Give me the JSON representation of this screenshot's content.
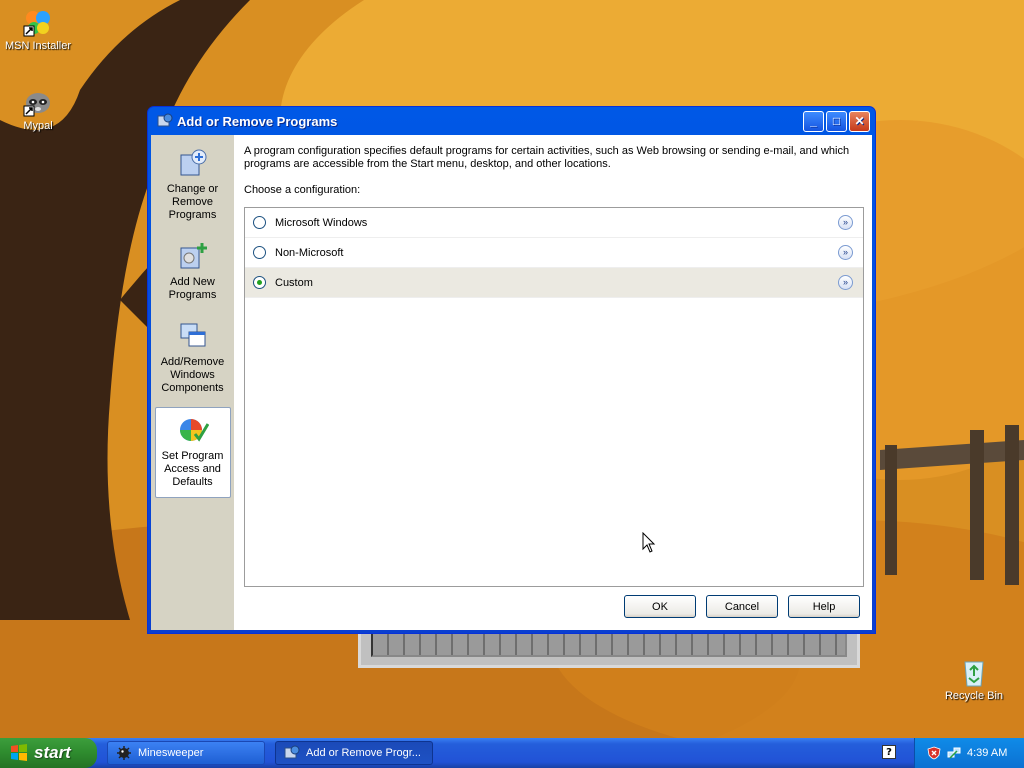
{
  "desktop": {
    "icons": [
      {
        "label": "MSN Installer",
        "icon": "msn-butterfly-icon"
      },
      {
        "label": "Mypal",
        "icon": "raccoon-icon"
      },
      {
        "label": "Recycle Bin",
        "icon": "recycle-bin-icon"
      }
    ]
  },
  "window": {
    "title": "Add or Remove Programs",
    "controls": {
      "minimize": "_",
      "maximize": "□",
      "close": "✕"
    }
  },
  "sidebar": {
    "items": [
      {
        "label": "Change or Remove Programs",
        "icon": "change-remove-programs-icon",
        "selected": false
      },
      {
        "label": "Add New Programs",
        "icon": "add-new-programs-icon",
        "selected": false
      },
      {
        "label": "Add/Remove Windows Components",
        "icon": "windows-components-icon",
        "selected": false
      },
      {
        "label": "Set Program Access and Defaults",
        "icon": "program-access-defaults-icon",
        "selected": true
      }
    ]
  },
  "main": {
    "intro": "A program configuration specifies default programs for certain activities, such as Web browsing or sending e-mail, and which programs are accessible from the Start menu, desktop, and other locations.",
    "choose_label": "Choose a configuration:",
    "configurations": [
      {
        "label": "Microsoft Windows",
        "selected": false
      },
      {
        "label": "Non-Microsoft",
        "selected": false
      },
      {
        "label": "Custom",
        "selected": true
      }
    ],
    "expand_glyph": "»"
  },
  "buttons": {
    "ok": "OK",
    "cancel": "Cancel",
    "help": "Help"
  },
  "taskbar": {
    "start_label": "start",
    "tasks": [
      {
        "label": "Minesweeper",
        "active": false
      },
      {
        "label": "Add or Remove Progr...",
        "active": true
      }
    ],
    "help_glyph": "?",
    "clock": "4:39 AM"
  },
  "colors": {
    "title_bar": "#0058e6",
    "taskbar": "#245edb",
    "start_button": "#2e8b2e",
    "dialog_face": "#ece9d8",
    "radio_selected": "#21a121"
  }
}
